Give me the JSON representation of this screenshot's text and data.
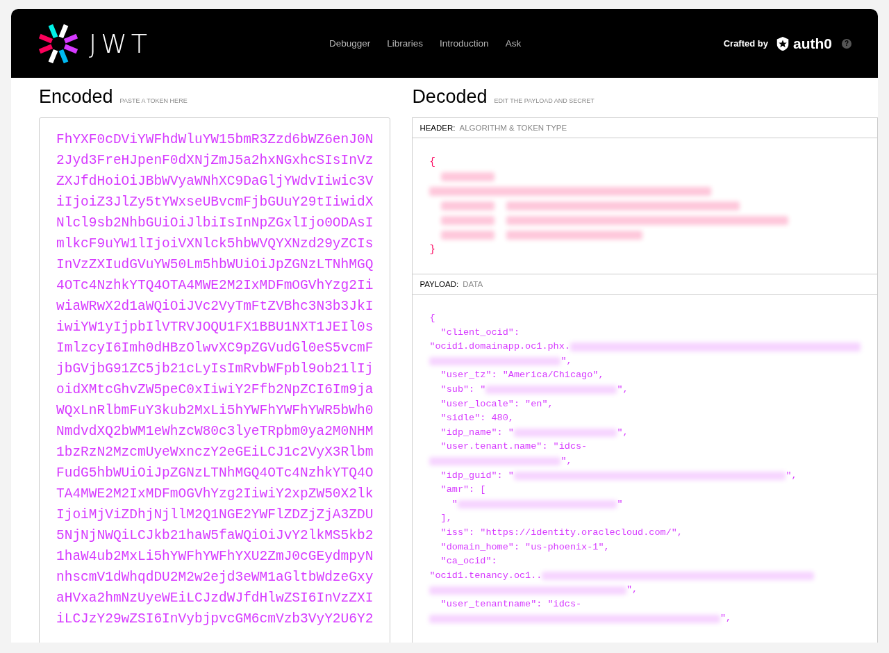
{
  "header": {
    "logo": {
      "text": "JWT"
    },
    "nav": [
      {
        "label": "Debugger"
      },
      {
        "label": "Libraries"
      },
      {
        "label": "Introduction"
      },
      {
        "label": "Ask"
      }
    ],
    "crafted_by": "Crafted by",
    "brand": "auth0",
    "help": "?"
  },
  "encoded": {
    "title": "Encoded",
    "hint": "PASTE A TOKEN HERE",
    "lines": [
      "FhYXF0cDViYWFhdWluYW15bmR3Zzd6bWZ6enJ0N",
      "2Jyd3FreHJpenF0dXNjZmJ5a2hxNGxhcSIsInVz",
      "ZXJfdHoiOiJBbWVyaWNhXC9DaGljYWdvIiwic3V",
      "iIjoiZ3JlZy5tYWxseUBvcmFjbGUuY29tIiwidX",
      "Nlcl9sb2NhbGUiOiJlbiIsInNpZGxlIjo0ODAsI",
      "mlkcF9uYW1lIjoiVXNlck5hbWVQYXNzd29yZCIs",
      "InVzZXIudGVuYW50Lm5hbWUiOiJpZGNzLTNhMGQ",
      "4OTc4NzhkYTQ4OTA4MWE2M2IxMDFmOGVhYzg2Ii",
      "wiaWRwX2d1aWQiOiJVc2VyTmFtZVBhc3N3b3JkI",
      "iwiYW1yIjpbIlVTRVJOQU1FX1BBU1NXT1JEIl0s",
      "ImlzcyI6Imh0dHBzOlwvXC9pZGVudGl0eS5vcmF",
      "jbGVjbG91ZC5jb21cLyIsImRvbWFpbl9ob21lIj",
      "oidXMtcGhvZW5peC0xIiwiY2Ffb2NpZCI6Im9ja",
      "WQxLnRlbmFuY3kub2MxLi5hYWFhYWFhYWR5bWh0",
      "NmdvdXQ2bWM1eWhzcW80c3lyeTRpbm0ya2M0NHM",
      "1bzRzN2MzcmUyeWxnczY2eGEiLCJ1c2VyX3Rlbm",
      "FudG5hbWUiOiJpZGNzLTNhMGQ4OTc4NzhkYTQ4O",
      "TA4MWE2M2IxMDFmOGVhYzg2IiwiY2xpZW50X2lk",
      "IjoiMjViZDhjNjllM2Q1NGE2YWFlZDZjZjA3ZDU",
      "5NjNjNWQiLCJkb21haW5faWQiOiJvY2lkMS5kb2",
      "1haW4ub2MxLi5hYWFhYWFhYXU2ZmJ0cGEydmpyN",
      "nhscmV1dWhqdDU2M2w2ejd3eWM1aGltbWdzeGxy",
      "aHVxa2hmNzUyeWEiLCJzdWJfdHlwZSI6InVzZXI",
      "iLCJzY29wZSI6InVybjpvcGM6cmVzb3VyY2U6Y2"
    ]
  },
  "decoded": {
    "title": "Decoded",
    "hint": "EDIT THE PAYLOAD AND SECRET",
    "panels": [
      {
        "label": "HEADER:",
        "sublabel": "ALGORITHM & TOKEN TYPE",
        "kind": "header",
        "lines": [
          [
            {
              "kind": "text",
              "text": "{"
            }
          ],
          [
            {
              "kind": "redacted",
              "indented": true
            }
          ],
          [
            {
              "kind": "redacted",
              "indented": false
            }
          ],
          [
            {
              "kind": "redacted",
              "indented": true
            },
            {
              "kind": "redacted",
              "indented": true
            }
          ],
          [
            {
              "kind": "redacted",
              "indented": true
            },
            {
              "kind": "redacted",
              "indented": true
            }
          ],
          [
            {
              "kind": "redacted",
              "indented": true
            },
            {
              "kind": "redacted",
              "indented": true
            }
          ],
          [
            {
              "kind": "text",
              "text": "}"
            }
          ]
        ]
      },
      {
        "label": "PAYLOAD:",
        "sublabel": "DATA",
        "kind": "payload",
        "lines": [
          [
            {
              "kind": "text",
              "text": "{"
            }
          ],
          [
            {
              "kind": "text",
              "text": "  \"client_ocid\":"
            }
          ],
          [
            {
              "kind": "text",
              "text": "\"ocid1.domainapp.oc1.phx."
            },
            {
              "kind": "redacted"
            }
          ],
          [
            {
              "kind": "redacted"
            },
            {
              "kind": "text",
              "text": "\","
            }
          ],
          [
            {
              "kind": "text",
              "text": "  \"user_tz\": \"America/Chicago\","
            }
          ],
          [
            {
              "kind": "text",
              "text": "  \"sub\": \""
            },
            {
              "kind": "redacted"
            },
            {
              "kind": "text",
              "text": "\","
            }
          ],
          [
            {
              "kind": "text",
              "text": "  \"user_locale\": \"en\","
            }
          ],
          [
            {
              "kind": "text",
              "text": "  \"sidle\": 480,"
            }
          ],
          [
            {
              "kind": "text",
              "text": "  \"idp_name\": \""
            },
            {
              "kind": "redacted"
            },
            {
              "kind": "text",
              "text": "\","
            }
          ],
          [
            {
              "kind": "text",
              "text": "  \"user.tenant.name\": \"idcs-"
            }
          ],
          [
            {
              "kind": "redacted"
            },
            {
              "kind": "text",
              "text": "\","
            }
          ],
          [
            {
              "kind": "text",
              "text": "  \"idp_guid\": \""
            },
            {
              "kind": "redacted"
            },
            {
              "kind": "text",
              "text": "\","
            }
          ],
          [
            {
              "kind": "text",
              "text": "  \"amr\": ["
            }
          ],
          [
            {
              "kind": "text",
              "text": "    \""
            },
            {
              "kind": "redacted"
            },
            {
              "kind": "text",
              "text": "\""
            }
          ],
          [
            {
              "kind": "text",
              "text": "  ],"
            }
          ],
          [
            {
              "kind": "text",
              "text": "  \"iss\": \"https://identity.oraclecloud.com/\","
            }
          ],
          [
            {
              "kind": "text",
              "text": "  \"domain_home\": \"us-phoenix-1\","
            }
          ],
          [
            {
              "kind": "text",
              "text": "  \"ca_ocid\":"
            }
          ],
          [
            {
              "kind": "text",
              "text": "\"ocid1.tenancy.oc1.."
            },
            {
              "kind": "redacted"
            }
          ],
          [
            {
              "kind": "redacted"
            },
            {
              "kind": "text",
              "text": "\","
            }
          ],
          [
            {
              "kind": "text",
              "text": "  \"user_tenantname\": \"idcs-"
            }
          ],
          [
            {
              "kind": "redacted"
            },
            {
              "kind": "text",
              "text": "\","
            }
          ]
        ]
      }
    ]
  }
}
